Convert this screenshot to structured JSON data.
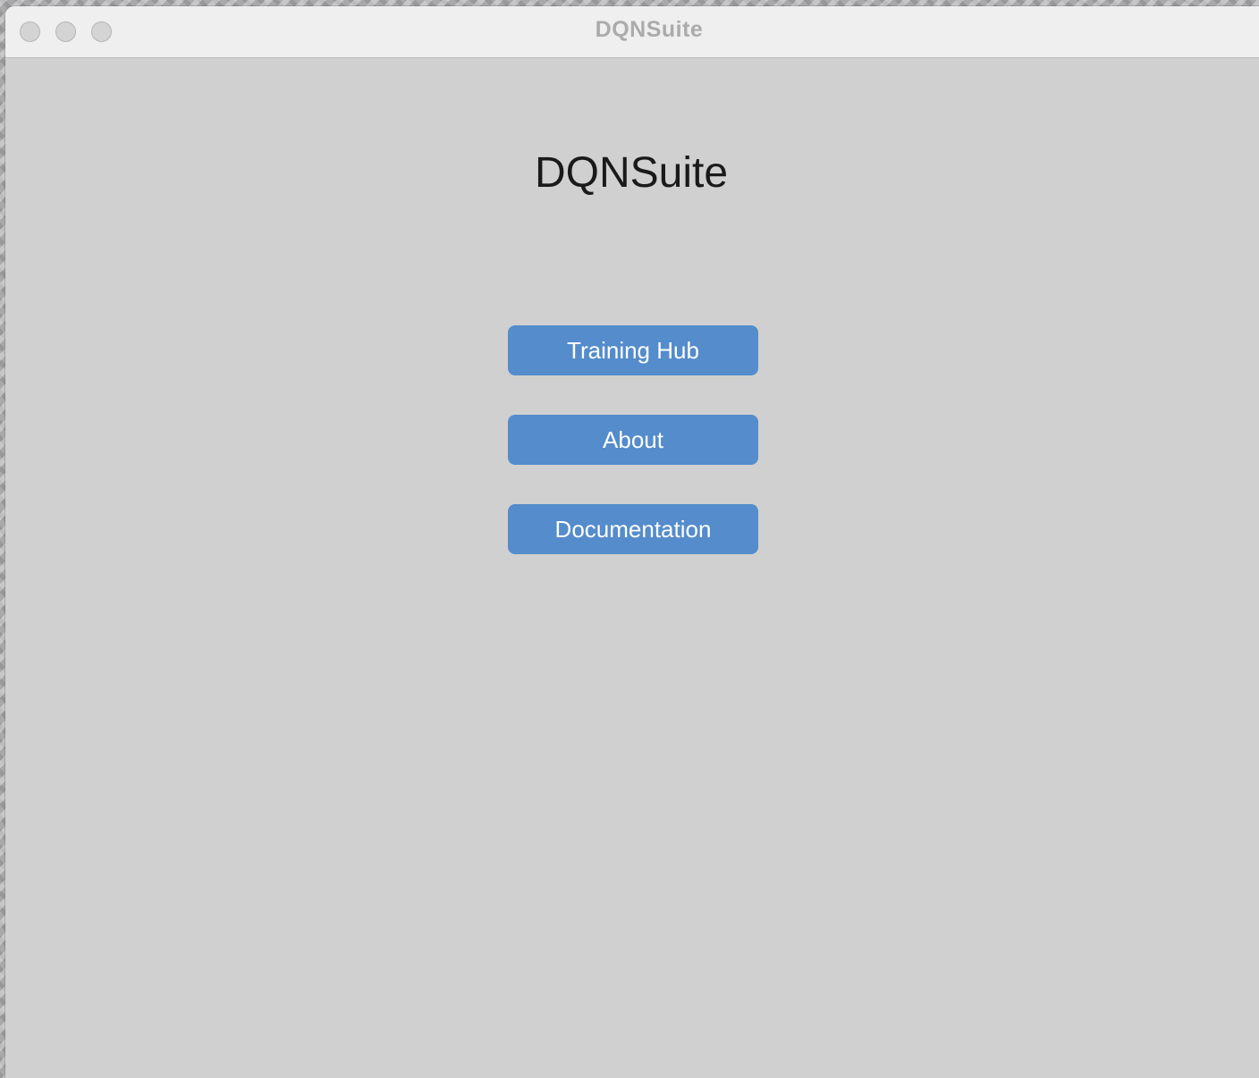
{
  "window": {
    "title": "DQNSuite"
  },
  "main": {
    "heading": "DQNSuite",
    "buttons": {
      "training_hub": "Training Hub",
      "about": "About",
      "documentation": "Documentation"
    }
  },
  "colors": {
    "accent": "#548ccc",
    "background": "#d0d0d0",
    "titlebar": "#efefef"
  }
}
